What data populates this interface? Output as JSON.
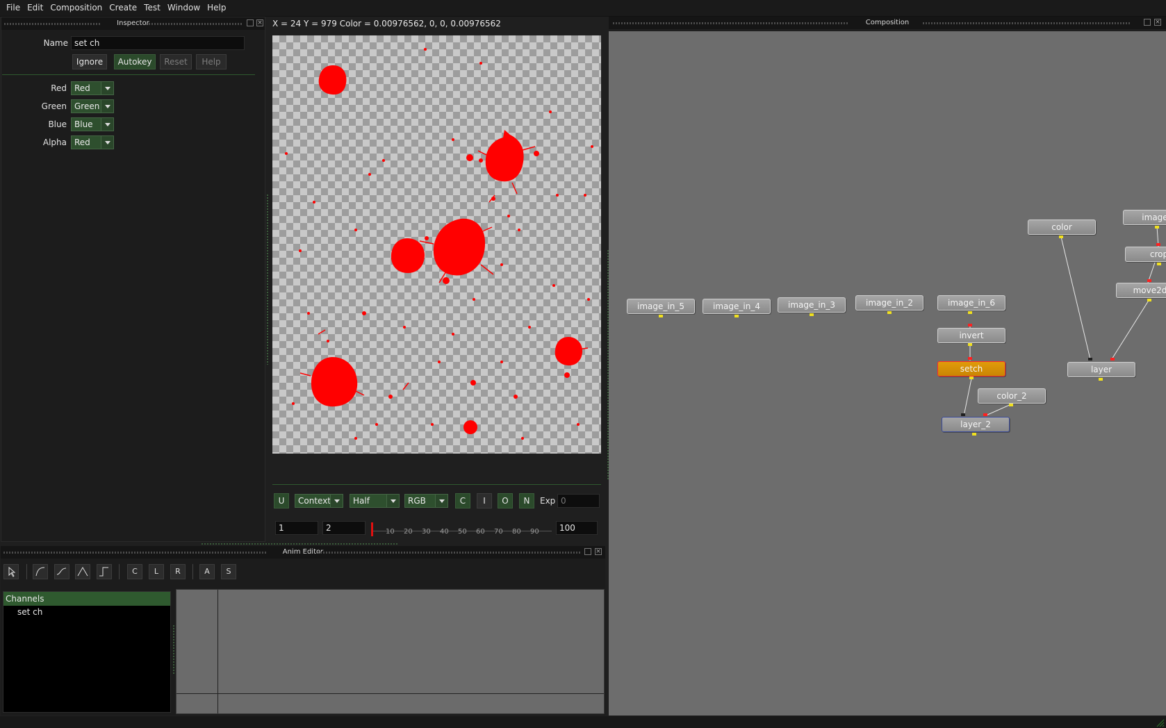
{
  "menubar": [
    "File",
    "Edit",
    "Composition",
    "Create",
    "Test",
    "Window",
    "Help"
  ],
  "inspector": {
    "title": "Inspector",
    "name_label": "Name",
    "name_value": "set ch",
    "buttons": {
      "ignore": "Ignore",
      "autokey": "Autokey",
      "reset": "Reset",
      "help": "Help"
    },
    "channels": [
      {
        "label": "Red",
        "value": "Red"
      },
      {
        "label": "Green",
        "value": "Green"
      },
      {
        "label": "Blue",
        "value": "Blue"
      },
      {
        "label": "Alpha",
        "value": "Red"
      }
    ]
  },
  "viewer": {
    "status": "X = 24 Y = 979 Color = 0.00976562, 0, 0, 0.00976562",
    "toolbar": {
      "u": "U",
      "context": "Context",
      "half": "Half",
      "rgb": "RGB",
      "c": "C",
      "i": "I",
      "o": "O",
      "n": "N",
      "exp_label": "Exp",
      "exp_value": "0"
    },
    "timeline": {
      "start": "1",
      "current": "2",
      "end": "100",
      "ticks": [
        "10",
        "20",
        "30",
        "40",
        "50",
        "60",
        "70",
        "80",
        "90"
      ]
    }
  },
  "anim_editor": {
    "title": "Anim Editor",
    "tools": [
      "C",
      "L",
      "R",
      "A",
      "S"
    ],
    "channels_header": "Channels",
    "channel_item": "set ch"
  },
  "composition": {
    "title": "Composition",
    "nodes": {
      "image_in_5": "image_in_5",
      "image_in_4": "image_in_4",
      "image_in_3": "image_in_3",
      "image_in_2": "image_in_2",
      "image_in_6": "image_in_6",
      "invert": "invert",
      "setch": "setch",
      "layer_2": "layer_2",
      "color_2": "color_2",
      "color": "color",
      "layer": "layer",
      "image_partial": "image_",
      "crop_partial": "crop",
      "move2d_partial": "move2d"
    }
  },
  "colors": {
    "splat": "#ff0000",
    "selected_node": "#d89307",
    "accent_green": "#2e4f2e"
  }
}
